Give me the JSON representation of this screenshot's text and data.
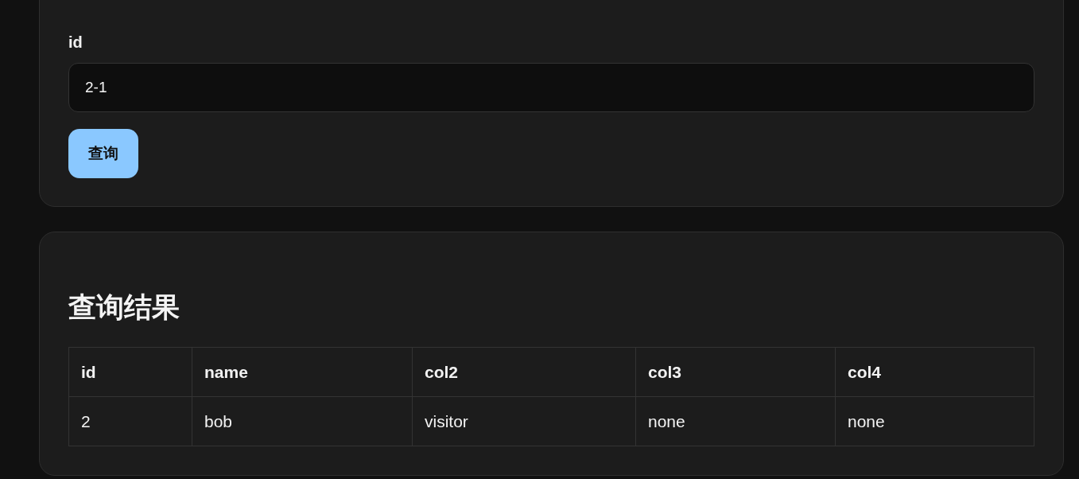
{
  "query_form": {
    "field_label": "id",
    "field_value": "2-1",
    "submit_button": "查询"
  },
  "results": {
    "heading": "查询结果",
    "table": {
      "columns": [
        "id",
        "name",
        "col2",
        "col3",
        "col4"
      ],
      "rows": [
        [
          "2",
          "bob",
          "visitor",
          "none",
          "none"
        ]
      ]
    }
  }
}
